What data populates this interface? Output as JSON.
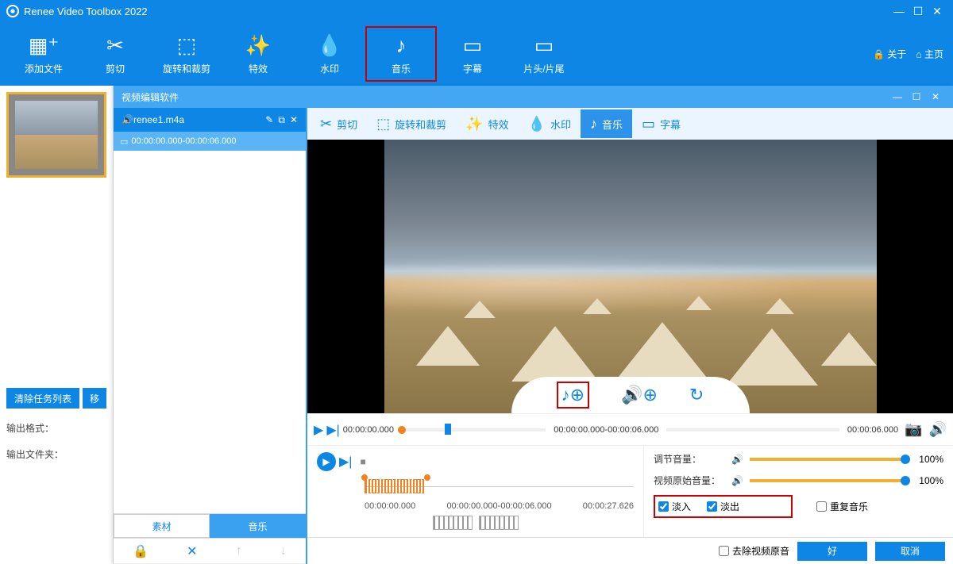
{
  "app": {
    "title": "Renee Video Toolbox 2022"
  },
  "toolbar": {
    "items": [
      {
        "label": "添加文件"
      },
      {
        "label": "剪切"
      },
      {
        "label": "旋转和裁剪"
      },
      {
        "label": "特效"
      },
      {
        "label": "水印"
      },
      {
        "label": "音乐"
      },
      {
        "label": "字幕"
      },
      {
        "label": "片头/片尾"
      }
    ],
    "about": "关于",
    "home": "主页"
  },
  "leftbtns": {
    "clear": "清除任务列表",
    "move": "移"
  },
  "leftlabels": {
    "format": "输出格式：",
    "folder": "输出文件夹："
  },
  "editor": {
    "title": "视频编辑软件"
  },
  "audio": {
    "name": "renee1.m4a",
    "tc": "00:00:00.000-00:00:06.000"
  },
  "sidetabs": {
    "material": "素材",
    "music": "音乐"
  },
  "subtabs": [
    {
      "label": "剪切"
    },
    {
      "label": "旋转和裁剪"
    },
    {
      "label": "特效"
    },
    {
      "label": "水印"
    },
    {
      "label": "音乐"
    },
    {
      "label": "字幕"
    }
  ],
  "tl": {
    "start": "00:00:00.000",
    "range": "00:00:00.000-00:00:06.000",
    "end": "00:00:06.000"
  },
  "wave": {
    "t0": "00:00:00.000",
    "t1": "00:00:00.000-00:00:06.000",
    "t2": "00:00:27.626"
  },
  "vols": {
    "adjust": "调节音量：",
    "orig": "视频原始音量：",
    "pct": "100%"
  },
  "checks": {
    "fadein": "淡入",
    "fadeout": "淡出",
    "repeat": "重复音乐",
    "remove": "去除视频原音"
  },
  "footer": {
    "ok": "好",
    "cancel": "取消"
  }
}
